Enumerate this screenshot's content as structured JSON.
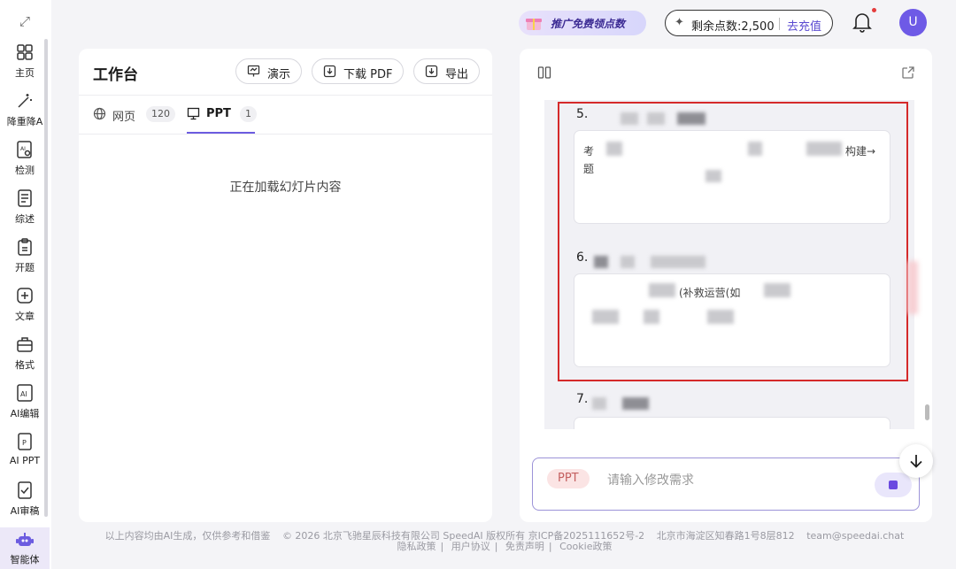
{
  "sidebar": {
    "items": [
      {
        "label": "主页",
        "icon": "home-grid-icon"
      },
      {
        "label": "降重降A",
        "icon": "magic-wand-icon"
      },
      {
        "label": "检测",
        "icon": "ai-search-icon"
      },
      {
        "label": "综述",
        "icon": "document-icon"
      },
      {
        "label": "开题",
        "icon": "clipboard-icon"
      },
      {
        "label": "文章",
        "icon": "article-icon"
      },
      {
        "label": "格式",
        "icon": "briefcase-icon"
      },
      {
        "label": "AI编辑",
        "icon": "ai-edit-icon"
      },
      {
        "label": "AI PPT",
        "icon": "ppt-icon"
      },
      {
        "label": "AI审稿",
        "icon": "review-icon"
      },
      {
        "label": "智能体",
        "icon": "robot-icon"
      }
    ]
  },
  "topbar": {
    "promo_text": "推广免费领点数",
    "points_text": "剩余点数:2,500",
    "recharge_label": "去充值",
    "avatar_letter": "U"
  },
  "workbench": {
    "title": "工作台",
    "buttons": {
      "present": "演示",
      "download_pdf": "下载 PDF",
      "export": "导出"
    },
    "tabs": [
      {
        "label": "网页",
        "count": "120"
      },
      {
        "label": "PPT",
        "count": "1"
      }
    ],
    "loading_text": "正在加载幻灯片内容"
  },
  "doc": {
    "item5_num": "5.",
    "item5_text_a": "考",
    "item5_text_b": "构建→",
    "item5_text_c": "题",
    "item6_num": "6.",
    "item6_text": "(补救运营(如",
    "item7_num": "7."
  },
  "chat": {
    "chip": "PPT",
    "placeholder": "请输入修改需求"
  },
  "footer": {
    "disclaimer": "以上内容均由AI生成，仅供参考和借鉴",
    "copyright": "© 2026 北京飞驰星辰科技有限公司 SpeedAI 版权所有 京ICP备2025111652号-2",
    "address": "北京市海淀区知春路1号8层812",
    "email": "team@speedai.chat",
    "links": [
      "隐私政策",
      "用户协议",
      "免责声明",
      "Cookie政策"
    ]
  },
  "colors": {
    "accent": "#6c5ce0",
    "avatar": "#6e5ae6",
    "highlight_box": "#d52a2a",
    "background": "#f4f4f7"
  }
}
